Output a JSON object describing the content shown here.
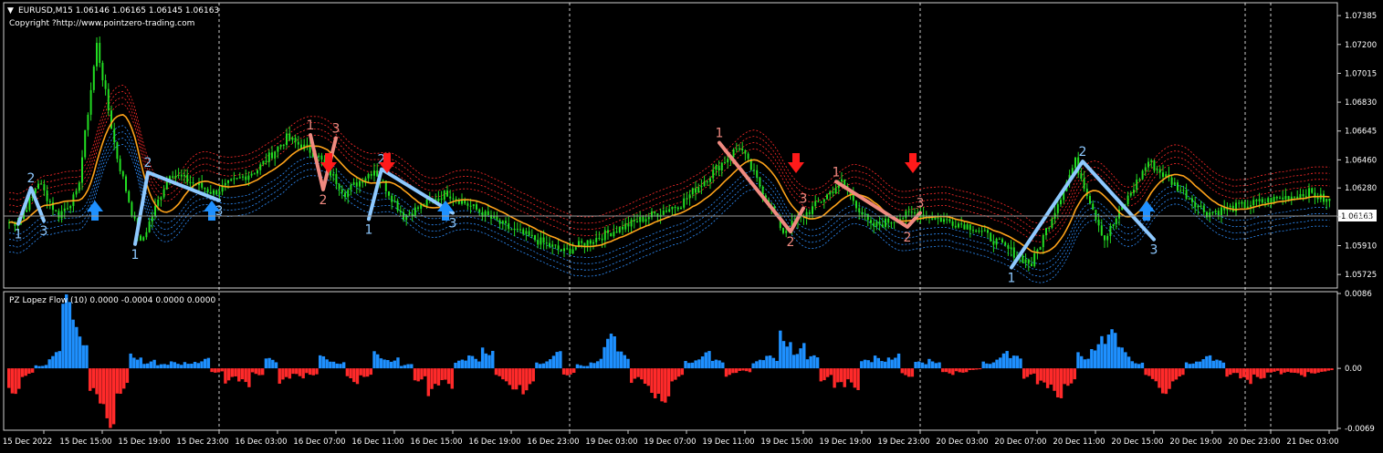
{
  "chart_header": {
    "symbol_line": "EURUSD,M15  1.06146 1.06165 1.06145 1.06163",
    "copyright": "Copyright ?http://www.pointzero-trading.com"
  },
  "indicator_header": "PZ Lopez Flow (10) 0.0000 -0.0004 0.0000 0.0000",
  "price_axis": {
    "ticks": [
      "1.07385",
      "1.07200",
      "1.07015",
      "1.06830",
      "1.06645",
      "1.06460",
      "1.06280",
      "1.06095",
      "1.05910",
      "1.05725"
    ],
    "current_price": "1.06163"
  },
  "indicator_axis": {
    "ticks": [
      "0.0086",
      "0.00",
      "-0.0069"
    ]
  },
  "time_axis": [
    "15 Dec 2022",
    "15 Dec 15:00",
    "15 Dec 19:00",
    "15 Dec 23:00",
    "16 Dec 03:00",
    "16 Dec 07:00",
    "16 Dec 11:00",
    "16 Dec 15:00",
    "16 Dec 19:00",
    "16 Dec 23:00",
    "19 Dec 03:00",
    "19 Dec 07:00",
    "19 Dec 11:00",
    "19 Dec 15:00",
    "19 Dec 19:00",
    "19 Dec 23:00",
    "20 Dec 03:00",
    "20 Dec 07:00",
    "20 Dec 11:00",
    "20 Dec 15:00",
    "20 Dec 19:00",
    "20 Dec 23:00",
    "21 Dec 03:00"
  ],
  "colors": {
    "background": "#000000",
    "candles": "#22dd22",
    "ma": "#ffa31a",
    "band_upper": "#ff2a2a",
    "band_lower": "#2e8fff",
    "pattern_bear": "#f08a80",
    "pattern_bull": "#8ec9ff",
    "hist_pos": "#1e90ff",
    "hist_neg": "#ff2a2a",
    "grid": "#ffffff",
    "arrow_up": "#1e90ff",
    "arrow_down": "#ff1a1a"
  },
  "chart_data": {
    "type": "candlestick",
    "symbol": "EURUSD",
    "timeframe": "M15",
    "ylim": [
      1.0565,
      1.0745
    ],
    "price_path": [
      [
        "15 Dec 2022",
        1.0606
      ],
      [
        "15 Dec 2022",
        1.0632
      ],
      [
        "15 Dec 2022",
        1.061
      ],
      [
        "15 Dec 15:00",
        1.0624
      ],
      [
        "15 Dec 15:00",
        1.072
      ],
      [
        "15 Dec 15:00",
        1.065
      ],
      [
        "15 Dec 19:00",
        1.0592
      ],
      [
        "15 Dec 19:00",
        1.0638
      ],
      [
        "15 Dec 23:00",
        1.0625
      ],
      [
        "16 Dec 03:00",
        1.064
      ],
      [
        "16 Dec 03:00",
        1.066
      ],
      [
        "16 Dec 07:00",
        1.065
      ],
      [
        "16 Dec 07:00",
        1.0625
      ],
      [
        "16 Dec 11:00",
        1.064
      ],
      [
        "16 Dec 11:00",
        1.061
      ],
      [
        "16 Dec 15:00",
        1.0625
      ],
      [
        "16 Dec 19:00",
        1.0603
      ],
      [
        "16 Dec 23:00",
        1.0587
      ],
      [
        "19 Dec 03:00",
        1.0603
      ],
      [
        "19 Dec 07:00",
        1.0618
      ],
      [
        "19 Dec 11:00",
        1.0655
      ],
      [
        "19 Dec 15:00",
        1.06
      ],
      [
        "19 Dec 15:00",
        1.0615
      ],
      [
        "19 Dec 19:00",
        1.0632
      ],
      [
        "19 Dec 19:00",
        1.0603
      ],
      [
        "19 Dec 23:00",
        1.0612
      ],
      [
        "20 Dec 03:00",
        1.0603
      ],
      [
        "20 Dec 07:00",
        1.0579
      ],
      [
        "20 Dec 11:00",
        1.0645
      ],
      [
        "20 Dec 11:00",
        1.0595
      ],
      [
        "20 Dec 15:00",
        1.0645
      ],
      [
        "20 Dec 19:00",
        1.0612
      ],
      [
        "21 Dec 03:00",
        1.0625
      ],
      [
        "21 Dec 03:00",
        1.06163
      ]
    ],
    "patterns": [
      {
        "kind": "bullish",
        "points": [
          [
            "15 Dec 2022",
            1.0605,
            "1"
          ],
          [
            "15 Dec 2022",
            1.0628,
            "2"
          ],
          [
            "15 Dec 2022",
            1.0607,
            "3"
          ]
        ]
      },
      {
        "kind": "bullish",
        "points": [
          [
            "15 Dec 19:00",
            1.0592,
            "1"
          ],
          [
            "15 Dec 19:00",
            1.0638,
            "2"
          ],
          [
            "15 Dec 23:00",
            1.062,
            "3"
          ]
        ]
      },
      {
        "kind": "bearish",
        "points": [
          [
            "16 Dec 07:00",
            1.0662,
            "1"
          ],
          [
            "16 Dec 07:00",
            1.0627,
            "2"
          ],
          [
            "16 Dec 07:00",
            1.066,
            "3"
          ]
        ]
      },
      {
        "kind": "bullish",
        "points": [
          [
            "16 Dec 11:00",
            1.0608,
            "1"
          ],
          [
            "16 Dec 11:00",
            1.064,
            "2"
          ],
          [
            "16 Dec 15:00",
            1.0612,
            "3"
          ]
        ]
      },
      {
        "kind": "bearish",
        "points": [
          [
            "19 Dec 11:00",
            1.0657,
            "1"
          ],
          [
            "19 Dec 15:00",
            1.06,
            "2"
          ],
          [
            "19 Dec 15:00",
            1.0615,
            "3"
          ]
        ]
      },
      {
        "kind": "bearish",
        "points": [
          [
            "19 Dec 19:00",
            1.0632,
            "1"
          ],
          [
            "19 Dec 23:00",
            1.0603,
            "2"
          ],
          [
            "19 Dec 23:00",
            1.0612,
            "3"
          ]
        ]
      },
      {
        "kind": "bullish",
        "points": [
          [
            "20 Dec 07:00",
            1.0577,
            "1"
          ],
          [
            "20 Dec 11:00",
            1.0645,
            "2"
          ],
          [
            "20 Dec 15:00",
            1.0595,
            "3"
          ]
        ]
      }
    ],
    "signals": [
      {
        "dir": "up",
        "time": "15 Dec 15:00"
      },
      {
        "dir": "up",
        "time": "15 Dec 23:00"
      },
      {
        "dir": "down",
        "time": "16 Dec 07:00"
      },
      {
        "dir": "down",
        "time": "16 Dec 11:00"
      },
      {
        "dir": "up",
        "time": "16 Dec 15:00"
      },
      {
        "dir": "down",
        "time": "19 Dec 15:00"
      },
      {
        "dir": "down",
        "time": "19 Dec 23:00"
      },
      {
        "dir": "up",
        "time": "20 Dec 15:00"
      }
    ],
    "indicator": {
      "name": "PZ Lopez Flow (10)",
      "ylim": [
        -0.0069,
        0.0086
      ],
      "series": [
        -0.003,
        -0.001,
        0.0005,
        0.002,
        0.0085,
        0.005,
        -0.0045,
        -0.0069,
        -0.003,
        0.002,
        0.001,
        0.0005,
        0.0008,
        0.001,
        0.0012,
        -0.0005,
        -0.0018,
        -0.0025,
        -0.0008,
        0.0012,
        -0.002,
        -0.0012,
        -0.0008,
        0.0015,
        0.001,
        -0.0018,
        -0.001,
        0.002,
        0.0015,
        0.0005,
        -0.0015,
        -0.0035,
        -0.0025,
        0.001,
        0.0015,
        0.003,
        -0.0015,
        -0.0025,
        -0.003,
        0.001,
        0.002,
        -0.0008,
        0.0005,
        0.0012,
        0.004,
        0.002,
        -0.002,
        -0.0035,
        -0.004,
        -0.0015,
        0.0012,
        0.002,
        0.001,
        -0.001,
        -0.0005,
        0.001,
        0.0015,
        0.005,
        0.003,
        0.0015,
        -0.0015,
        -0.003,
        -0.0025,
        0.001,
        0.0015,
        0.002,
        -0.001,
        0.0008,
        0.0012,
        -0.0008,
        -0.0005,
        -0.0002,
        0.001,
        0.002,
        0.0015,
        -0.0012,
        -0.0028,
        -0.0035,
        -0.002,
        0.002,
        0.004,
        0.0045,
        0.0025,
        0.001,
        -0.0015,
        -0.003,
        -0.0015,
        0.001,
        0.0015,
        0.001,
        -0.001,
        -0.002,
        -0.0012,
        -0.0005,
        -0.0008,
        -0.001,
        -0.0006,
        -0.0004
      ]
    }
  }
}
